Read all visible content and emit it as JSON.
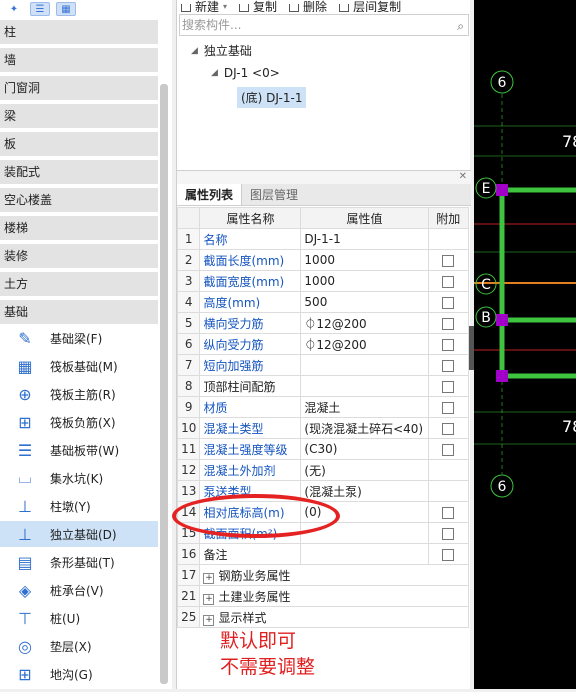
{
  "left_nav": {
    "categories": [
      "柱",
      "墙",
      "门窗洞",
      "梁",
      "板",
      "装配式",
      "空心楼盖",
      "楼梯",
      "装修",
      "土方",
      "基础"
    ],
    "items": [
      {
        "label": "基础梁(F)",
        "icon": "foundation-beam-icon"
      },
      {
        "label": "筏板基础(M)",
        "icon": "raft-foundation-icon"
      },
      {
        "label": "筏板主筋(R)",
        "icon": "raft-main-rebar-icon"
      },
      {
        "label": "筏板负筋(X)",
        "icon": "raft-negative-rebar-icon"
      },
      {
        "label": "基础板带(W)",
        "icon": "foundation-strip-icon"
      },
      {
        "label": "集水坑(K)",
        "icon": "sump-pit-icon"
      },
      {
        "label": "柱墩(Y)",
        "icon": "column-pier-icon"
      },
      {
        "label": "独立基础(D)",
        "icon": "isolated-footing-icon",
        "active": true
      },
      {
        "label": "条形基础(T)",
        "icon": "strip-footing-icon"
      },
      {
        "label": "桩承台(V)",
        "icon": "pile-cap-icon"
      },
      {
        "label": "桩(U)",
        "icon": "pile-icon"
      },
      {
        "label": "垫层(X)",
        "icon": "cushion-icon"
      },
      {
        "label": "地沟(G)",
        "icon": "trench-icon"
      }
    ]
  },
  "toolbar": {
    "new_label": "新建",
    "copy_label": "复制",
    "delete_label": "删除",
    "floor_copy_label": "层间复制"
  },
  "search": {
    "placeholder": "搜索构件..."
  },
  "tree": {
    "root": "独立基础",
    "child": "DJ-1 <0>",
    "leaf": "(底) DJ-1-1"
  },
  "tabs": {
    "props": "属性列表",
    "layers": "图层管理"
  },
  "grid": {
    "headers": {
      "name": "属性名称",
      "value": "属性值",
      "extra": "附加"
    },
    "rows": [
      {
        "n": "1",
        "name": "名称",
        "value": "DJ-1-1",
        "blue": true,
        "cb": false
      },
      {
        "n": "2",
        "name": "截面长度(mm)",
        "value": "1000",
        "blue": true,
        "cb": true
      },
      {
        "n": "3",
        "name": "截面宽度(mm)",
        "value": "1000",
        "blue": true,
        "cb": true
      },
      {
        "n": "4",
        "name": "高度(mm)",
        "value": "500",
        "blue": true,
        "cb": true
      },
      {
        "n": "5",
        "name": "横向受力筋",
        "value": "⏀12@200",
        "blue": true,
        "cb": true
      },
      {
        "n": "6",
        "name": "纵向受力筋",
        "value": "⏀12@200",
        "blue": true,
        "cb": true
      },
      {
        "n": "7",
        "name": "短向加强筋",
        "value": "",
        "blue": true,
        "cb": true
      },
      {
        "n": "8",
        "name": "顶部柱间配筋",
        "value": "",
        "blue": false,
        "cb": true
      },
      {
        "n": "9",
        "name": "材质",
        "value": "混凝土",
        "blue": true,
        "cb": true
      },
      {
        "n": "10",
        "name": "混凝土类型",
        "value": "(现浇混凝土碎石<40)",
        "blue": true,
        "cb": true
      },
      {
        "n": "11",
        "name": "混凝土强度等级",
        "value": "(C30)",
        "blue": true,
        "cb": true
      },
      {
        "n": "12",
        "name": "混凝土外加剂",
        "value": "(无)",
        "blue": true,
        "cb": false
      },
      {
        "n": "13",
        "name": "泵送类型",
        "value": "(混凝土泵)",
        "blue": true,
        "cb": false
      },
      {
        "n": "14",
        "name": "相对底标高(m)",
        "value": "(0)",
        "blue": true,
        "cb": true
      },
      {
        "n": "15",
        "name": "截面面积(m²)",
        "value": "",
        "blue": true,
        "cb": true
      },
      {
        "n": "16",
        "name": "备注",
        "value": "",
        "blue": false,
        "cb": true
      },
      {
        "n": "17",
        "name": "钢筋业务属性",
        "value": "",
        "group": true
      },
      {
        "n": "21",
        "name": "土建业务属性",
        "value": "",
        "group": true
      },
      {
        "n": "25",
        "name": "显示样式",
        "value": "",
        "group": true
      }
    ]
  },
  "note": {
    "line1": "默认即可",
    "line2": "不需要调整"
  },
  "cad": {
    "axis_top": "6",
    "axis_bottom": "6",
    "axis_e": "E",
    "axis_c": "C",
    "axis_b": "B",
    "dim_top": "78",
    "dim_bottom": "78",
    "colors": {
      "bg": "#000000",
      "green": "#3ec43e",
      "magenta": "#a000c8",
      "orange": "#e08020",
      "red": "#c02020"
    }
  }
}
